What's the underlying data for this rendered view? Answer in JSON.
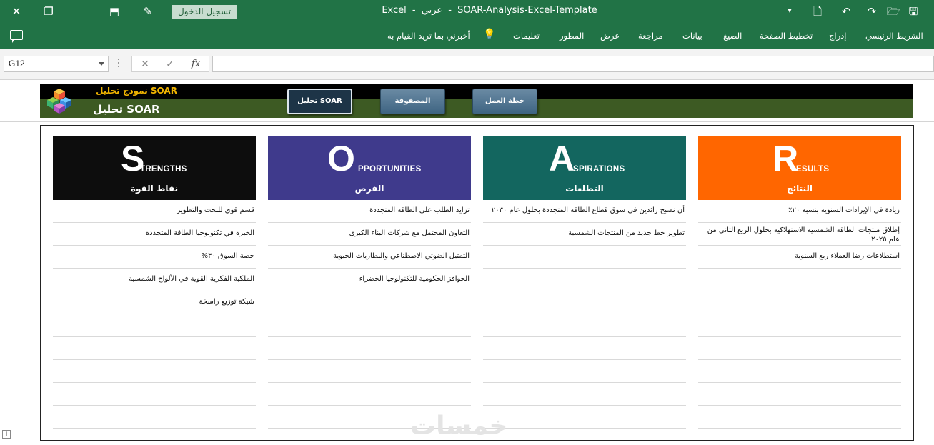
{
  "titlebar": {
    "app": "Excel",
    "separator": "-",
    "language": "عربي",
    "document": "SOAR-Analysis-Excel-Template",
    "login_label": "تسجيل الدخول",
    "icons": [
      "close-icon",
      "restore-icon",
      "ribbon-display-icon",
      "pen-icon",
      "dropdown-icon",
      "file-icon",
      "undo-icon",
      "redo-icon",
      "open-icon",
      "save-icon"
    ]
  },
  "ribbon": {
    "tabs": [
      "الشريط الرئيسي",
      "إدراج",
      "تخطيط الصفحة",
      "الصيغ",
      "بيانات",
      "مراجعة",
      "عرض",
      "المطور",
      "تعليمات"
    ],
    "tell_me": "أخبرني بما تريد القيام به"
  },
  "formula_bar": {
    "cell_ref": "G12",
    "cancel_glyph": "✕",
    "enter_glyph": "✓",
    "fx_glyph": "fx",
    "formula": ""
  },
  "banner": {
    "subtitle": "نموذج تحليل SOAR",
    "title": "تحليل SOAR",
    "buttons": [
      "تحليل SOAR",
      "المصفوفة",
      "خطة العمل"
    ],
    "active_button": "تحليل SOAR"
  },
  "soar": [
    {
      "letter": "S",
      "rest": "TRENGTHS",
      "arabic": "نقاط القوة",
      "color": "#0d0d0d",
      "items": [
        "قسم قوي للبحث والتطوير",
        "الخبرة في تكنولوجيا الطاقة المتجددة",
        "حصة السوق ٣٠%",
        "الملكية الفكرية القوية في الألواح الشمسية",
        "شبكة توزيع راسخة",
        "",
        "",
        "",
        "",
        ""
      ]
    },
    {
      "letter": "O",
      "rest": "PPORTUNITIES",
      "arabic": "الفرص",
      "color": "#3f3a8c",
      "items": [
        "تزايد الطلب على الطاقة المتجددة",
        "التعاون المحتمل مع شركات البناء الكبرى",
        "التمثيل الضوئي الاصطناعي والبطاريات الحيوية",
        "الحوافز الحكومية للتكنولوجيا الخضراء",
        "",
        "",
        "",
        "",
        "",
        ""
      ]
    },
    {
      "letter": "A",
      "rest": "SPIRATIONS",
      "arabic": "التطلعات",
      "color": "#13665f",
      "items": [
        "أن نصبح رائدين في سوق قطاع الطاقة المتجددة بحلول عام ٢٠٣٠",
        "تطوير خط جديد من المنتجات الشمسية",
        "",
        "",
        "",
        "",
        "",
        "",
        "",
        ""
      ]
    },
    {
      "letter": "R",
      "rest": "ESULTS",
      "arabic": "النتائج",
      "color": "#ff6600",
      "items": [
        "زيادة في الإيرادات السنوية بنسبة ٢٠٪",
        "إطلاق منتجات الطاقة الشمسية الاستهلاكية بحلول الربع الثاني من عام ٢٠٢٥",
        "استطلاعات رضا العملاء ربع السنوية",
        "",
        "",
        "",
        "",
        "",
        "",
        ""
      ]
    }
  ],
  "watermark": "خمسات"
}
